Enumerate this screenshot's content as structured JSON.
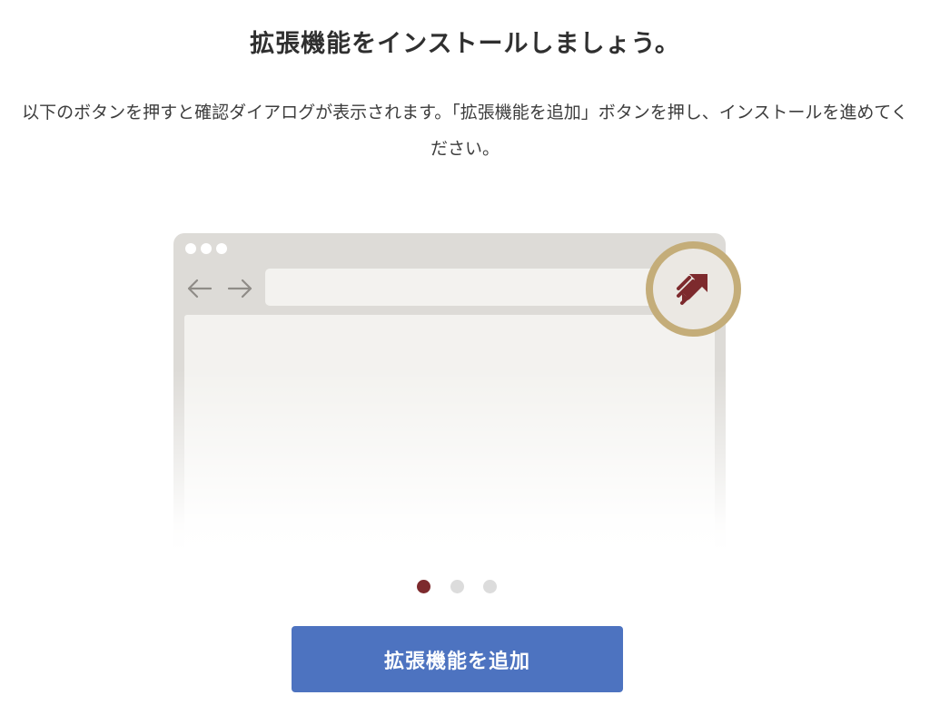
{
  "header": {
    "title": "拡張機能をインストールしましょう。"
  },
  "instructions": {
    "text": "以下のボタンを押すと確認ダイアログが表示されます。「拡張機能を追加」ボタンを押し、インストールを進めてください。"
  },
  "illustration": {
    "back_icon": "arrow-left-icon",
    "forward_icon": "arrow-right-icon",
    "extension_icon": "extension-hand-arrow-icon",
    "colors": {
      "frame": "#dddbd7",
      "surface": "#f3f2ef",
      "ring": "#c4ad79",
      "icon": "#7d2a2d"
    }
  },
  "carousel": {
    "slide_count": 3,
    "active_index": 0,
    "active_color": "#7d2a2d",
    "inactive_color": "#dcdcdc"
  },
  "actions": {
    "add_extension_label": "拡張機能を追加",
    "button_color": "#4d73c0"
  }
}
